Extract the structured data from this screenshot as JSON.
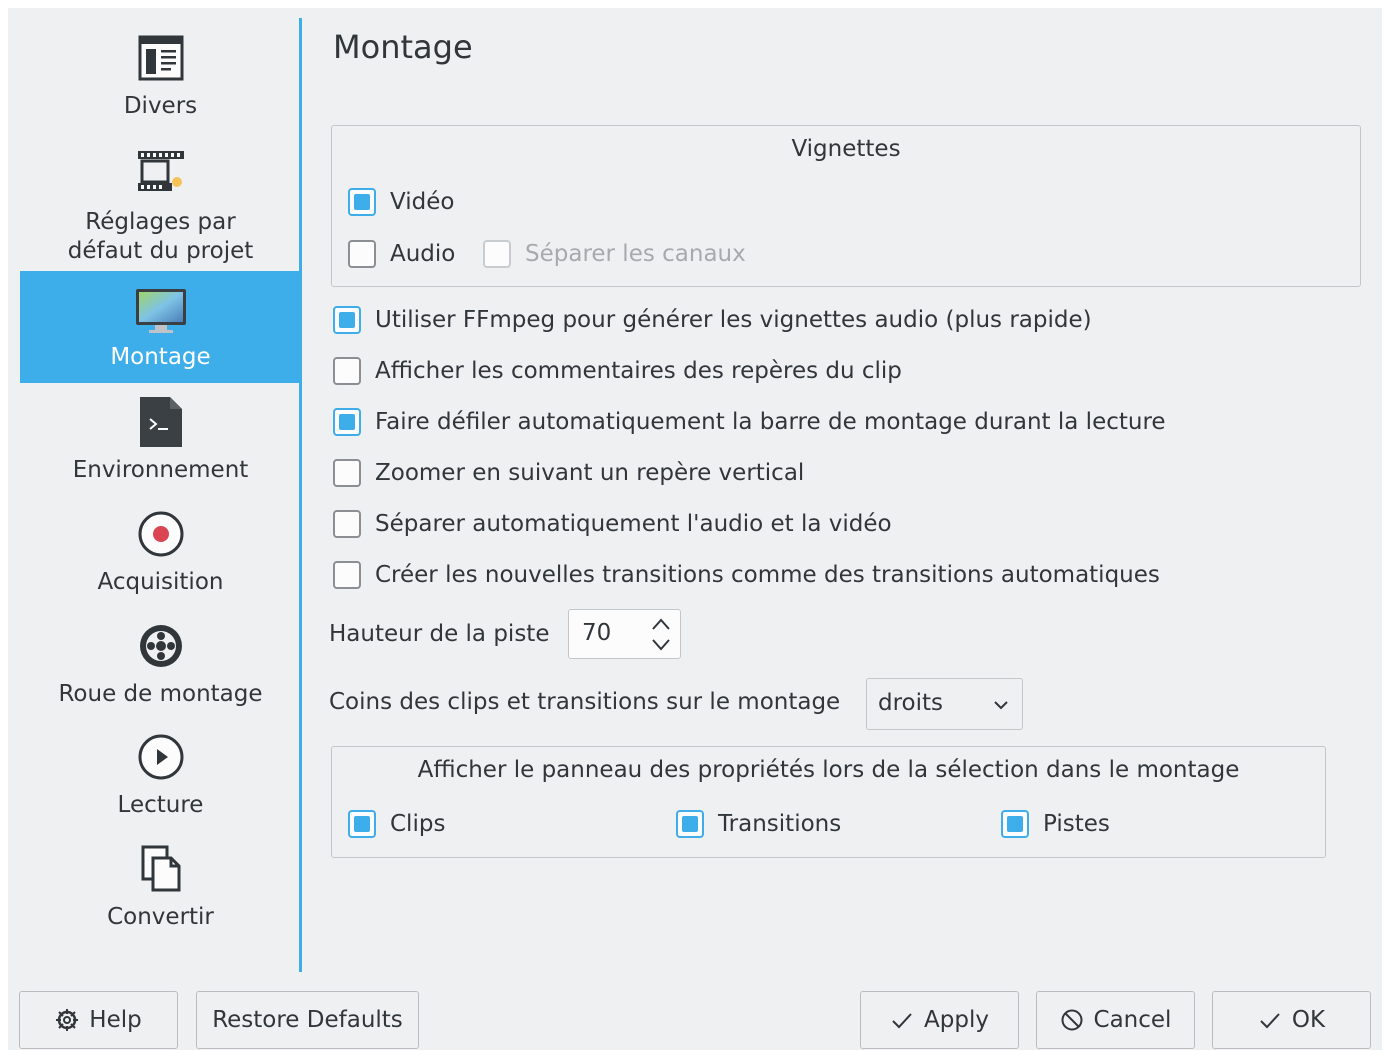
{
  "page": {
    "title": "Montage"
  },
  "sidebar": {
    "items": [
      {
        "label": "Divers",
        "icon": "misc-icon"
      },
      {
        "label": "Réglages par défaut du projet",
        "icon": "film-project-icon"
      },
      {
        "label": "Montage",
        "icon": "timeline-monitor-icon",
        "selected": true
      },
      {
        "label": "Environnement",
        "icon": "terminal-icon"
      },
      {
        "label": "Acquisition",
        "icon": "record-icon"
      },
      {
        "label": "Roue de montage",
        "icon": "jog-wheel-icon"
      },
      {
        "label": "Lecture",
        "icon": "play-icon"
      },
      {
        "label": "Convertir",
        "icon": "convert-icon"
      }
    ]
  },
  "thumbnails": {
    "title": "Vignettes",
    "video": {
      "label": "Vidéo",
      "checked": true
    },
    "audio": {
      "label": "Audio",
      "checked": false
    },
    "separate_channels": {
      "label": "Séparer les canaux",
      "checked": false,
      "enabled": false
    }
  },
  "options": [
    {
      "label": "Utiliser FFmpeg pour générer les vignettes audio (plus rapide)",
      "checked": true
    },
    {
      "label": "Afficher les commentaires des repères du clip",
      "checked": false
    },
    {
      "label": "Faire défiler automatiquement la barre de montage durant la lecture",
      "checked": true
    },
    {
      "label": "Zoomer en suivant un repère vertical",
      "checked": false
    },
    {
      "label": "Séparer automatiquement l'audio et la vidéo",
      "checked": false
    },
    {
      "label": "Créer les nouvelles transitions comme des transitions automatiques",
      "checked": false
    }
  ],
  "track_height": {
    "label": "Hauteur de la piste",
    "value": "70"
  },
  "corners": {
    "label": "Coins des clips et transitions sur le montage",
    "value": "droits"
  },
  "properties_panel": {
    "title": "Afficher le panneau des propriétés lors de la sélection dans le montage",
    "clips": {
      "label": "Clips",
      "checked": true
    },
    "transitions": {
      "label": "Transitions",
      "checked": true
    },
    "tracks": {
      "label": "Pistes",
      "checked": true
    }
  },
  "buttons": {
    "help": "Help",
    "restore": "Restore Defaults",
    "apply": "Apply",
    "cancel": "Cancel",
    "ok": "OK"
  },
  "colors": {
    "accent": "#3daee9",
    "background": "#eff0f1",
    "text": "#31363b"
  }
}
